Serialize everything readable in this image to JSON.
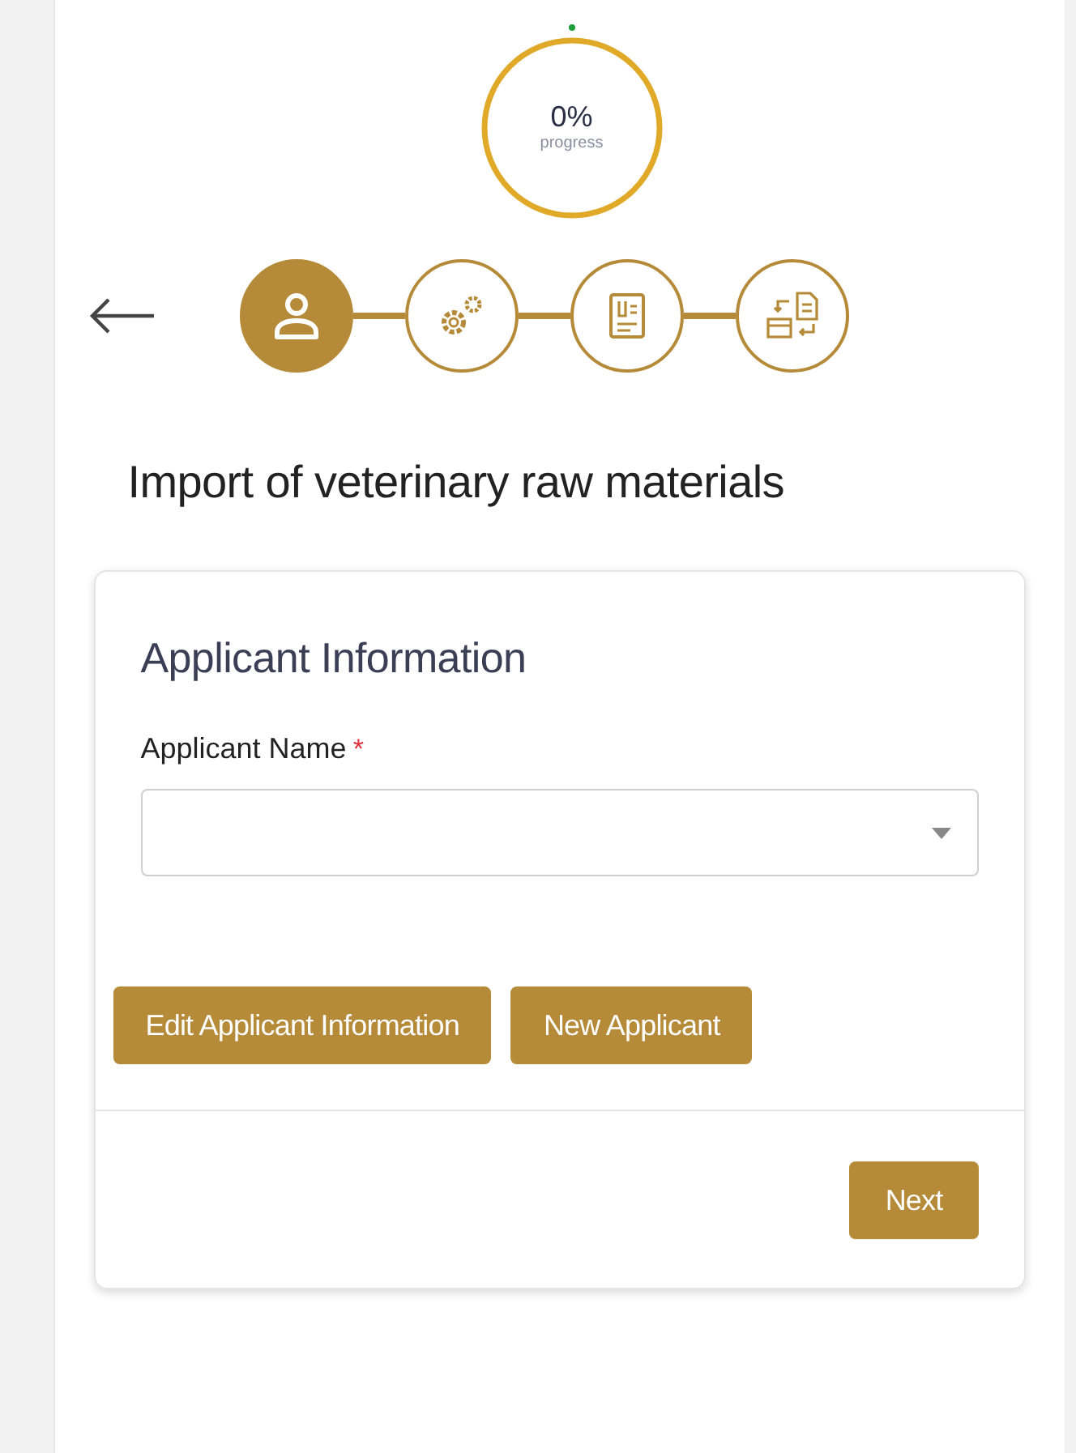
{
  "progress": {
    "value": "0%",
    "label": "progress"
  },
  "steps": [
    {
      "kind": "applicant",
      "selected": true
    },
    {
      "kind": "settings",
      "selected": false
    },
    {
      "kind": "document",
      "selected": false
    },
    {
      "kind": "exchange",
      "selected": false
    }
  ],
  "title": "Import of veterinary raw materials",
  "card": {
    "heading": "Applicant Information",
    "field": {
      "label": "Applicant Name",
      "required_mark": "*"
    },
    "actions": [
      "Edit Applicant Information",
      "New Applicant"
    ],
    "next": "Next"
  }
}
